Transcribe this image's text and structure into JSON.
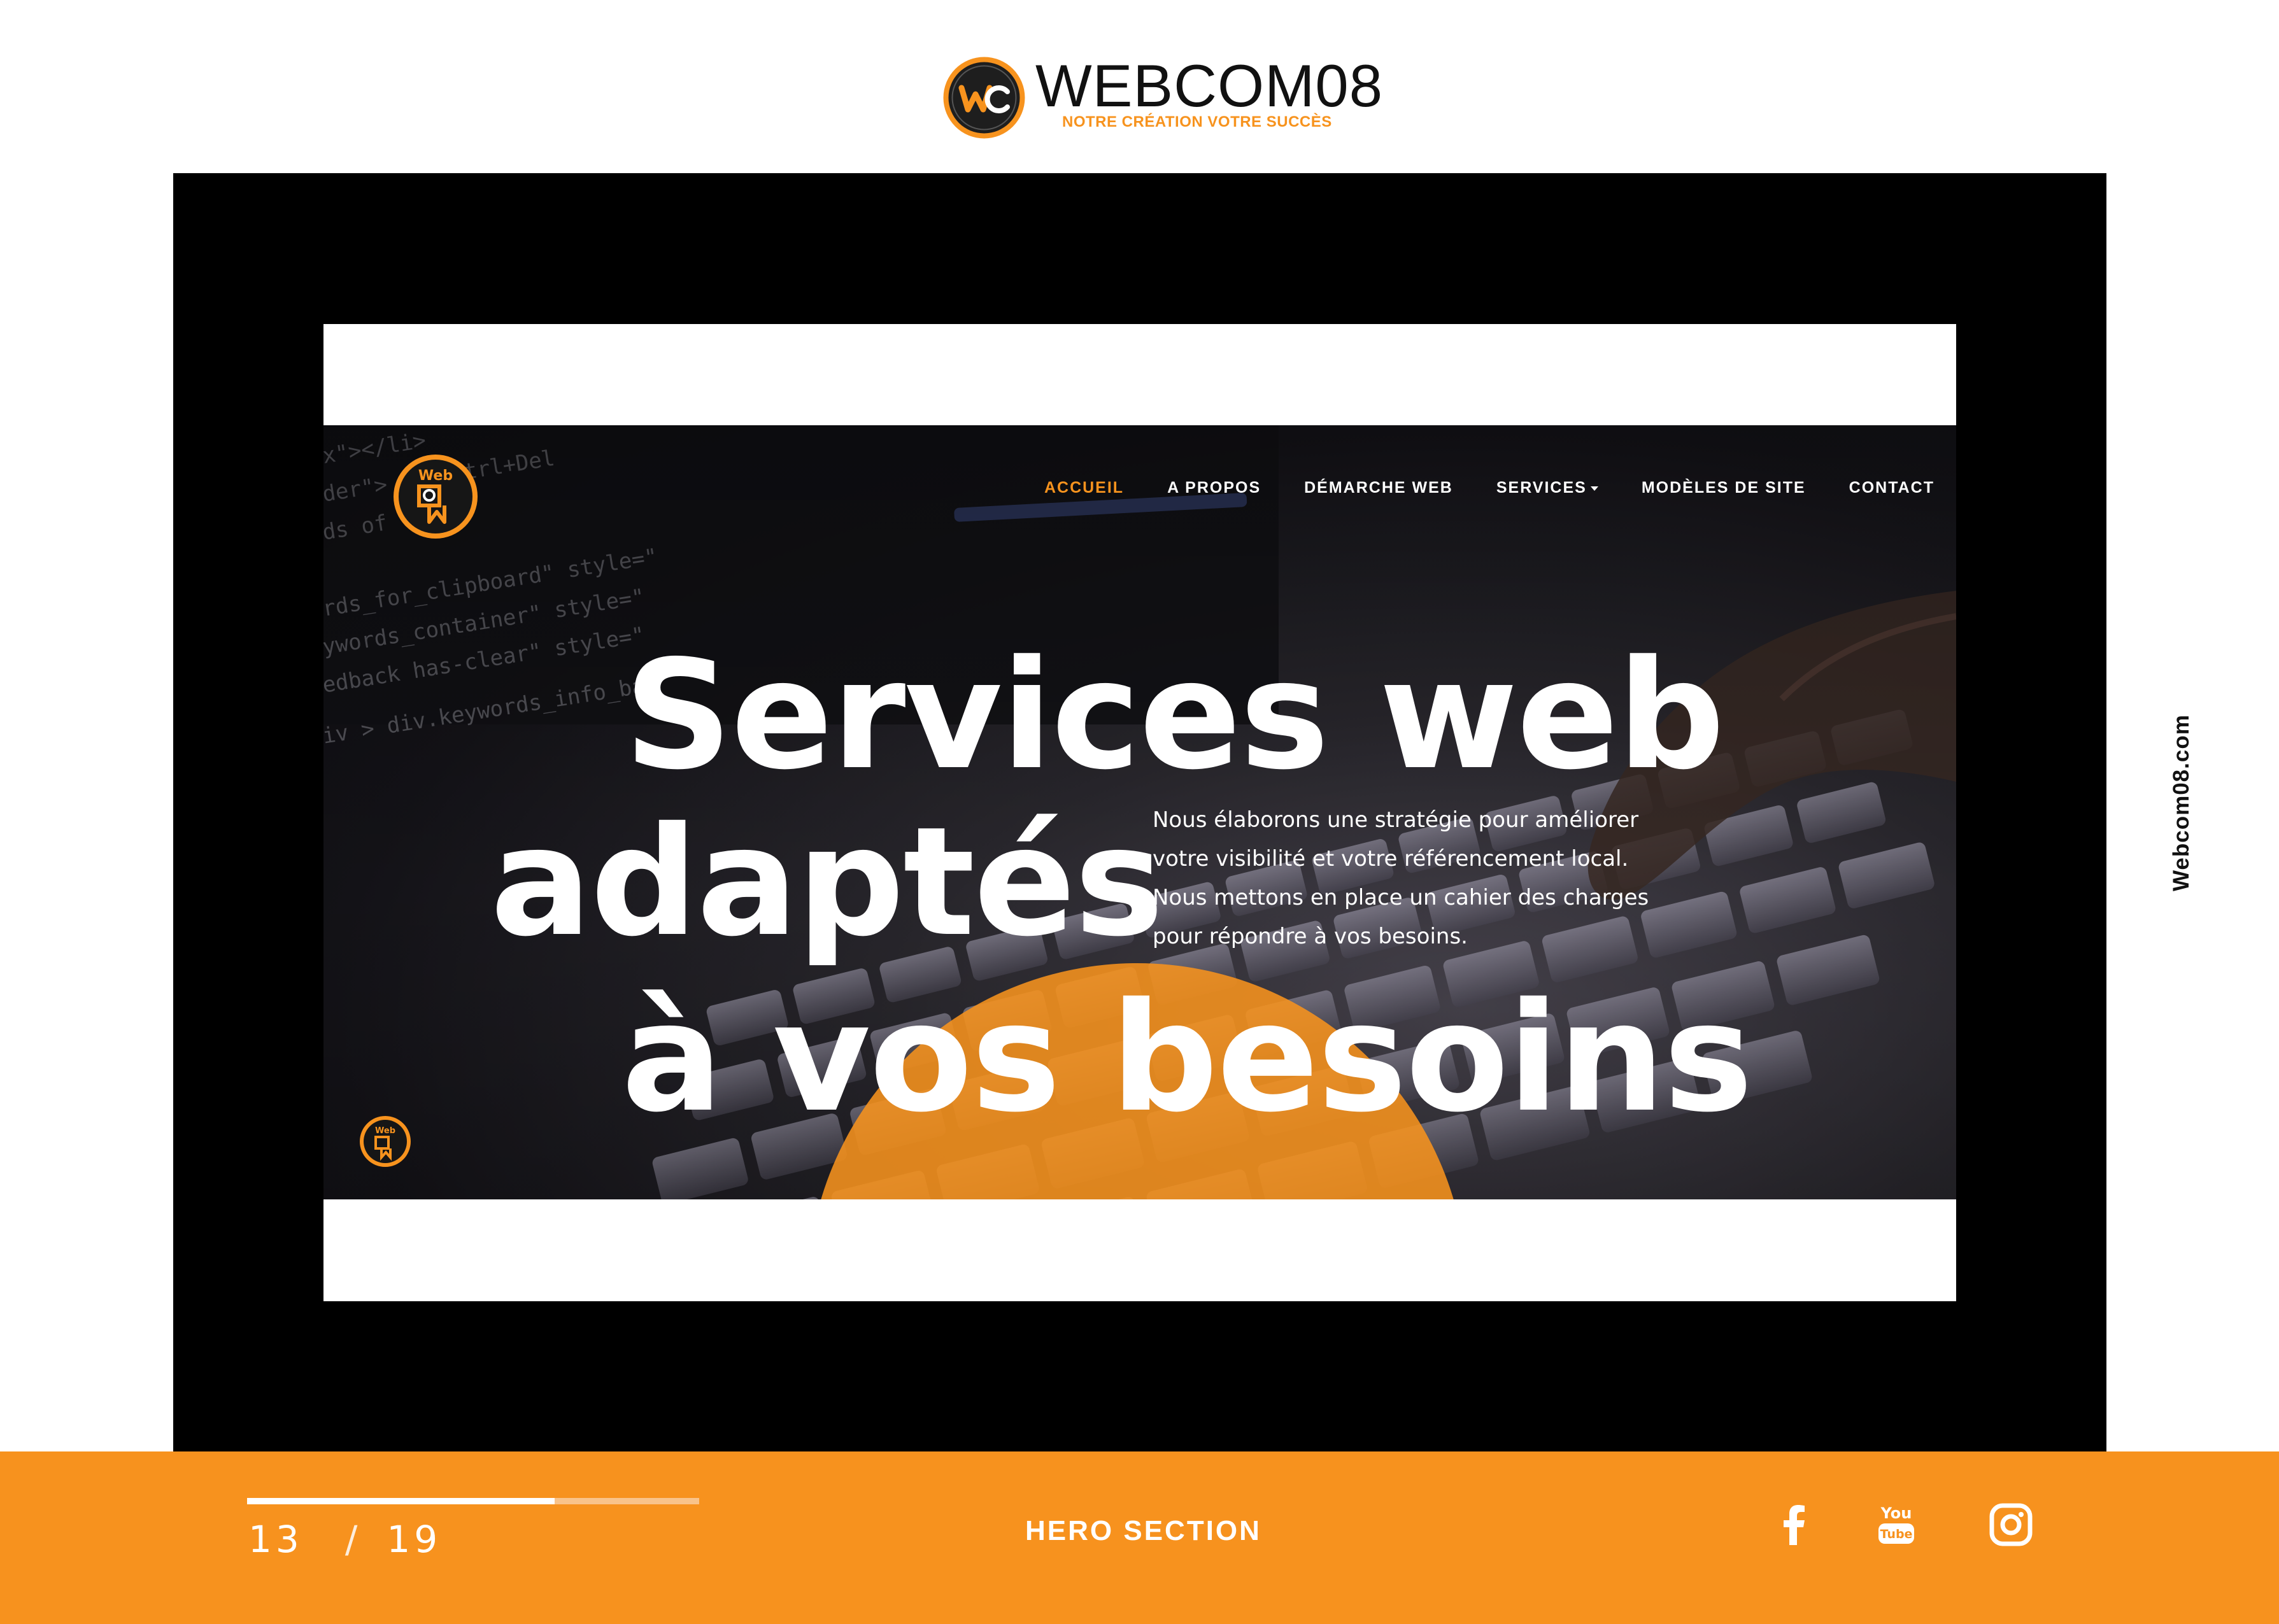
{
  "brand": {
    "name": "WEBCOM08",
    "tagline": "NOTRE CRÉATION VOTRE SUCCÈS",
    "logo_letter": "WC"
  },
  "site": {
    "logo_icon": "webcom-badge-icon",
    "nav": [
      {
        "label": "ACCUEIL",
        "active": true
      },
      {
        "label": "A PROPOS",
        "active": false
      },
      {
        "label": "DÉMARCHE WEB",
        "active": false
      },
      {
        "label": "SERVICES",
        "active": false,
        "dropdown": true
      },
      {
        "label": "MODÈLES DE SITE",
        "active": false
      },
      {
        "label": "CONTACT",
        "active": false
      }
    ],
    "hero": {
      "line1": "Services web",
      "line2": "adaptés",
      "line3": "à vos besoins",
      "description": "Nous élaborons une stratégie pour améliorer votre visibilité et votre référencement local. Nous mettons en place un cahier des charges pour répondre à vos besoins."
    }
  },
  "footer": {
    "current_page": "13",
    "separator": "/",
    "total_pages": "19",
    "progress_fraction": 0.68,
    "section_title": "HERO SECTION",
    "social": [
      "facebook-icon",
      "youtube-icon",
      "instagram-icon"
    ]
  },
  "side_label": "Webcom08.com",
  "colors": {
    "accent": "#f7921e",
    "frame": "#000000",
    "text_light": "#ffffff"
  }
}
